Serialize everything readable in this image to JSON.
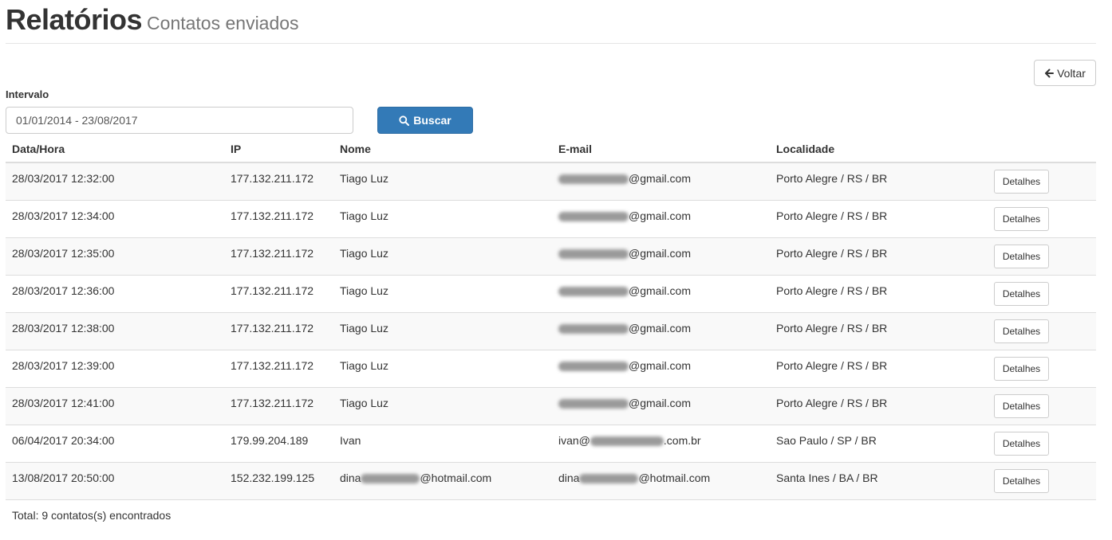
{
  "header": {
    "title": "Relatórios",
    "subtitle": "Contatos enviados"
  },
  "back_button": {
    "label": "Voltar",
    "icon": "arrow-left-icon"
  },
  "filter": {
    "label": "Intervalo",
    "value": "01/01/2014 - 23/08/2017",
    "search_label": "Buscar",
    "search_icon": "search-icon"
  },
  "table": {
    "columns": [
      "Data/Hora",
      "IP",
      "Nome",
      "E-mail",
      "Localidade"
    ],
    "rows": [
      {
        "datetime": "28/03/2017 12:32:00",
        "ip": "177.132.211.172",
        "name": "Tiago Luz",
        "email_suffix": "@gmail.com",
        "location": "Porto Alegre / RS / BR",
        "action": "Detalhes"
      },
      {
        "datetime": "28/03/2017 12:34:00",
        "ip": "177.132.211.172",
        "name": "Tiago Luz",
        "email_suffix": "@gmail.com",
        "location": "Porto Alegre / RS / BR",
        "action": "Detalhes"
      },
      {
        "datetime": "28/03/2017 12:35:00",
        "ip": "177.132.211.172",
        "name": "Tiago Luz",
        "email_suffix": "@gmail.com",
        "location": "Porto Alegre / RS / BR",
        "action": "Detalhes"
      },
      {
        "datetime": "28/03/2017 12:36:00",
        "ip": "177.132.211.172",
        "name": "Tiago Luz",
        "email_suffix": "@gmail.com",
        "location": "Porto Alegre / RS / BR",
        "action": "Detalhes"
      },
      {
        "datetime": "28/03/2017 12:38:00",
        "ip": "177.132.211.172",
        "name": "Tiago Luz",
        "email_suffix": "@gmail.com",
        "location": "Porto Alegre / RS / BR",
        "action": "Detalhes"
      },
      {
        "datetime": "28/03/2017 12:39:00",
        "ip": "177.132.211.172",
        "name": "Tiago Luz",
        "email_suffix": "@gmail.com",
        "location": "Porto Alegre / RS / BR",
        "action": "Detalhes"
      },
      {
        "datetime": "28/03/2017 12:41:00",
        "ip": "177.132.211.172",
        "name": "Tiago Luz",
        "email_suffix": "@gmail.com",
        "location": "Porto Alegre / RS / BR",
        "action": "Detalhes"
      },
      {
        "datetime": "06/04/2017 20:34:00",
        "ip": "179.99.204.189",
        "name": "Ivan",
        "email_prefix": "ivan@",
        "email_suffix": ".com.br",
        "location": "Sao Paulo / SP / BR",
        "action": "Detalhes"
      },
      {
        "datetime": "13/08/2017 20:50:00",
        "ip": "152.232.199.125",
        "name_prefix": "dina",
        "name_suffix": "@hotmail.com",
        "email_prefix": "dina",
        "email_suffix": "@hotmail.com",
        "location": "Santa Ines / BA / BR",
        "action": "Detalhes"
      }
    ]
  },
  "footer": {
    "total": "Total: 9 contatos(s) encontrados"
  }
}
